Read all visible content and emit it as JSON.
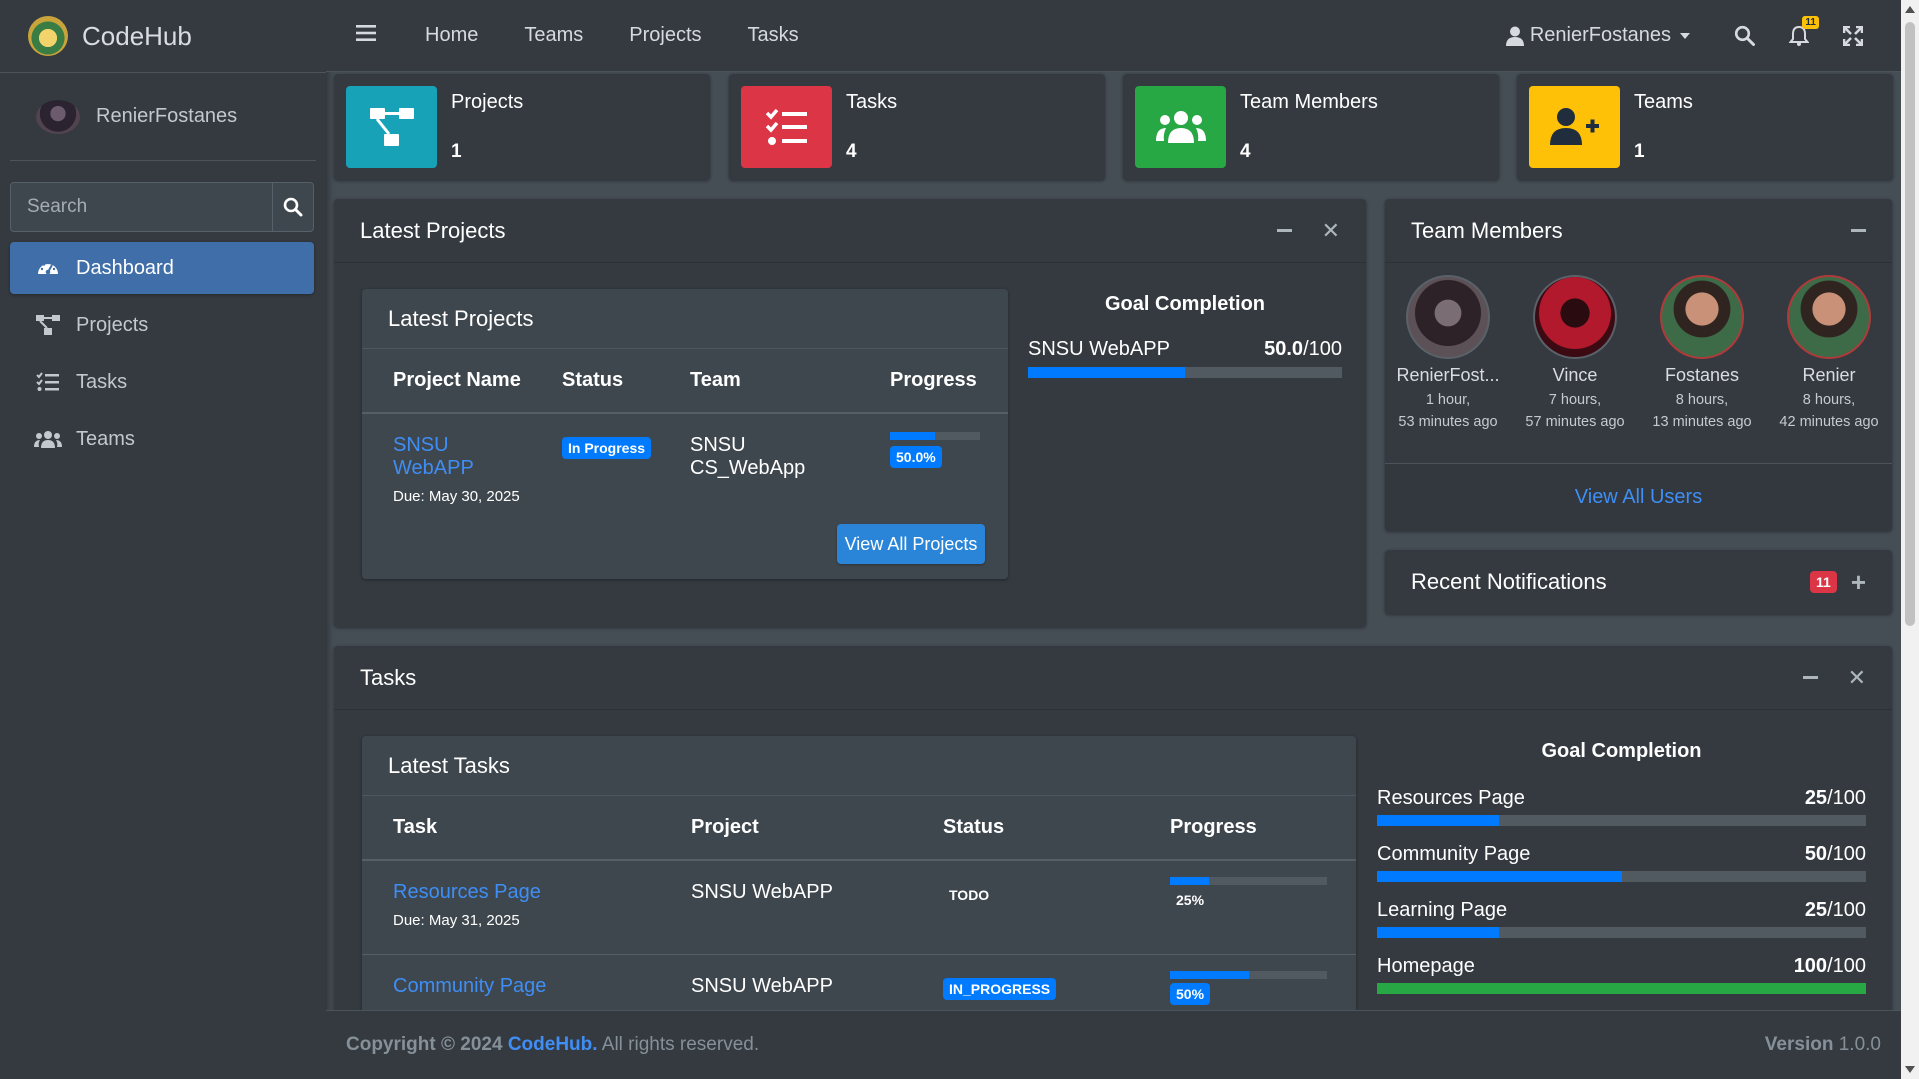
{
  "brand": {
    "name": "CodeHub"
  },
  "sidebar": {
    "user_name": "RenierFostanes",
    "search_placeholder": "Search",
    "items": [
      {
        "label": "Dashboard",
        "icon": "tachometer-icon",
        "active": true
      },
      {
        "label": "Projects",
        "icon": "project-diagram-icon"
      },
      {
        "label": "Tasks",
        "icon": "tasks-icon"
      },
      {
        "label": "Teams",
        "icon": "users-icon"
      }
    ]
  },
  "topbar": {
    "links": [
      "Home",
      "Teams",
      "Projects",
      "Tasks"
    ],
    "user_menu": "RenierFostanes",
    "notification_count": "11"
  },
  "info_boxes": [
    {
      "label": "Projects",
      "value": "1",
      "color": "#17a2b8",
      "icon": "project-diagram-icon"
    },
    {
      "label": "Tasks",
      "value": "4",
      "color": "#dc3545",
      "icon": "tasks-icon"
    },
    {
      "label": "Team Members",
      "value": "4",
      "color": "#28a745",
      "icon": "users-icon"
    },
    {
      "label": "Teams",
      "value": "1",
      "color": "#ffc107",
      "icon": "user-plus-icon"
    }
  ],
  "latest_projects": {
    "card_title": "Latest Projects",
    "inner_title": "Latest Projects",
    "columns": [
      "Project Name",
      "Status",
      "Team",
      "Progress"
    ],
    "rows": [
      {
        "name": "SNSU WebAPP",
        "due": "Due: May 30, 2025",
        "status": "In Progress",
        "team": "SNSU CS_WebApp",
        "progress": 0.5,
        "progress_label": "50.0%"
      }
    ],
    "view_all": "View All Projects",
    "goal_title": "Goal Completion",
    "goals": [
      {
        "name": "SNSU WebAPP",
        "value": "50.0",
        "max": "/100",
        "fraction": 0.5
      }
    ]
  },
  "team_members": {
    "title": "Team Members",
    "members": [
      {
        "name": "RenierFost...",
        "time1": "1 hour,",
        "time2": "53 minutes ago"
      },
      {
        "name": "Vince",
        "time1": "7 hours,",
        "time2": "57 minutes ago"
      },
      {
        "name": "Fostanes",
        "time1": "8 hours,",
        "time2": "13 minutes ago"
      },
      {
        "name": "Renier",
        "time1": "8 hours,",
        "time2": "42 minutes ago"
      }
    ],
    "view_all": "View All Users"
  },
  "notifications": {
    "title": "Recent Notifications",
    "count": "11"
  },
  "tasks": {
    "card_title": "Tasks",
    "inner_title": "Latest Tasks",
    "columns": [
      "Task",
      "Project",
      "Status",
      "Progress"
    ],
    "rows": [
      {
        "name": "Resources Page",
        "due": "Due: May 31, 2025",
        "project": "SNSU WebAPP",
        "status": "TODO",
        "progress": 0.25,
        "progress_label": "25%"
      },
      {
        "name": "Community Page",
        "due": "",
        "project": "SNSU WebAPP",
        "status": "IN_PROGRESS",
        "progress": 0.5,
        "progress_label": "50%"
      }
    ],
    "goal_title": "Goal Completion",
    "goals": [
      {
        "name": "Resources Page",
        "value": "25",
        "max": "/100",
        "fraction": 0.25,
        "color": "#007bff"
      },
      {
        "name": "Community Page",
        "value": "50",
        "max": "/100",
        "fraction": 0.5,
        "color": "#007bff"
      },
      {
        "name": "Learning Page",
        "value": "25",
        "max": "/100",
        "fraction": 0.25,
        "color": "#007bff"
      },
      {
        "name": "Homepage",
        "value": "100",
        "max": "/100",
        "fraction": 1.0,
        "color": "#28a745"
      }
    ]
  },
  "footer": {
    "copyright_prefix": "Copyright © 2024",
    "brand": "CodeHub.",
    "rights": "All rights reserved.",
    "version_label": "Version",
    "version": "1.0.0"
  }
}
